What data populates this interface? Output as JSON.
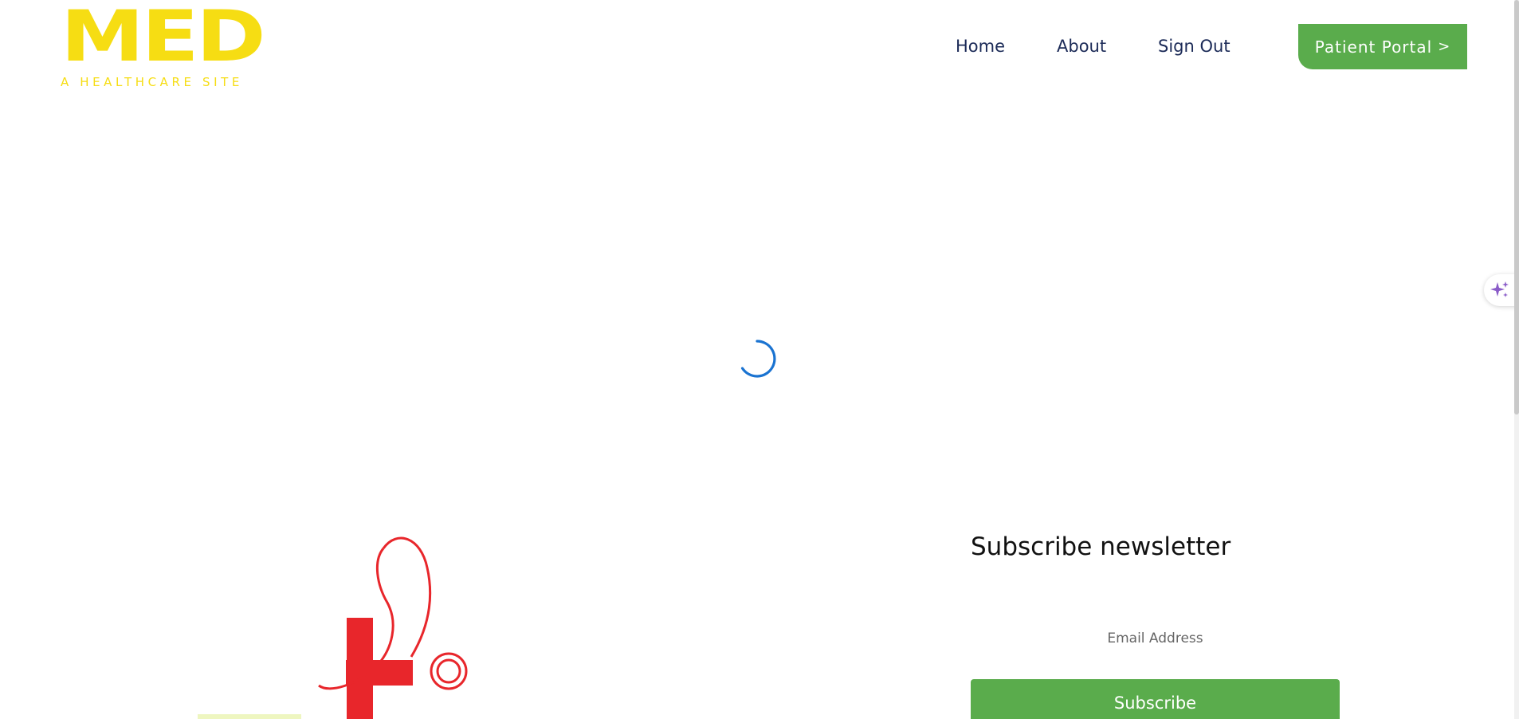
{
  "header": {
    "logo": {
      "mark": "MED",
      "tagline": "A HEALTHCARE SITE"
    },
    "nav": [
      {
        "label": "Home"
      },
      {
        "label": "About"
      },
      {
        "label": "Sign Out"
      }
    ],
    "portal_button": {
      "label": "Patient Portal",
      "chevron": ">"
    }
  },
  "main": {
    "loading_icon": "loading-spinner-icon"
  },
  "side_widget": {
    "icon": "sparkle-icon"
  },
  "newsletter": {
    "title": "Subscribe newsletter",
    "email_placeholder": "Email Address",
    "subscribe_label": "Subscribe"
  },
  "colors": {
    "brand_yellow": "#f6dd13",
    "nav_text": "#1b2a57",
    "accent_green": "#5aac4c",
    "spinner_blue": "#1a73d1",
    "cross_red": "#e8262b",
    "sparkle_purple": "#8a5cc8"
  }
}
